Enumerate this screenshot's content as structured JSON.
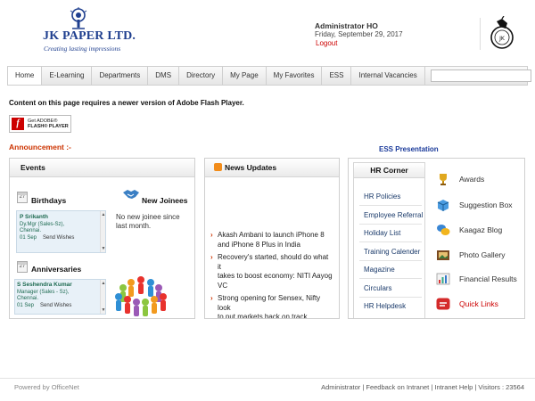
{
  "brand": {
    "name": "JK PAPER LTD.",
    "tagline": "Creating lasting impressions"
  },
  "user": {
    "name": "Administrator HO",
    "date": "Friday, September 29, 2017",
    "logout_label": "Logout"
  },
  "nav": {
    "tabs": [
      {
        "label": "Home",
        "active": true
      },
      {
        "label": "E-Learning"
      },
      {
        "label": "Departments"
      },
      {
        "label": "DMS"
      },
      {
        "label": "Directory"
      },
      {
        "label": "My Page"
      },
      {
        "label": "My Favorites"
      },
      {
        "label": "ESS"
      },
      {
        "label": "Internal Vacancies"
      }
    ],
    "search_value": ""
  },
  "flash": {
    "message": "Content on this page requires a newer version of Adobe Flash Player.",
    "badge_line1": "Get ADOBE®",
    "badge_line2": "FLASH® PLAYER"
  },
  "announcement_label": "Announcement :-",
  "ess_label": "ESS Presentation",
  "events": {
    "title": "Events",
    "birthdays": {
      "title": "Birthdays",
      "calendar_day": "27",
      "person": {
        "name": "P Srikanth",
        "designation": "Dy.Mgr (Sales-Sz),",
        "location": "Chennai.",
        "date": "01 Sep",
        "action": "Send Wishes"
      }
    },
    "anniversaries": {
      "title": "Anniversaries",
      "calendar_day": "27",
      "person": {
        "name": "S Seshendra Kumar",
        "designation": "Manager (Sales - Sz),",
        "location": "Chennai.",
        "date": "01 Sep",
        "action": "Send Wishes"
      }
    },
    "new_joinees": {
      "title": "New Joinees",
      "text_line1": "No new joinee since",
      "text_line2": "last month."
    }
  },
  "news": {
    "title": "News Updates",
    "items": [
      {
        "line1": "Akash Ambani to launch iPhone 8",
        "line2": "and iPhone 8 Plus in India"
      },
      {
        "line1": "Recovery's started, should do what it",
        "line2": "takes to boost economy: NITI Aayog",
        "line3": "VC"
      },
      {
        "line1": "Strong opening for Sensex, Nifty look",
        "line2": "to put markets back on track"
      }
    ]
  },
  "hr_corner": {
    "title": "HR Corner",
    "links": [
      "HR Policies",
      "Employee Referral",
      "Holiday List",
      "Training Calender",
      "Magazine",
      "Circulars",
      "HR Helpdesk"
    ],
    "features": [
      {
        "label": "Awards",
        "icon": "trophy-icon"
      },
      {
        "label": "Suggestion Box",
        "icon": "box-icon"
      },
      {
        "label": "Kaagaz Blog",
        "icon": "chat-bubbles-icon"
      },
      {
        "label": "Photo Gallery",
        "icon": "photo-icon"
      },
      {
        "label": "Financial Results",
        "icon": "chart-icon"
      },
      {
        "label": "Quick Links",
        "icon": "quick-links-icon",
        "highlight": true
      }
    ]
  },
  "footer": {
    "left": "Powered by OfficeNet",
    "right": "Administrator | Feedback on Intranet | Intranet Help | Visitors : 23564"
  },
  "colors": {
    "brand_blue": "#1f3f8f",
    "accent_red": "#cc0000",
    "announcement": "#cc3300",
    "event_text": "#1d6a50"
  }
}
